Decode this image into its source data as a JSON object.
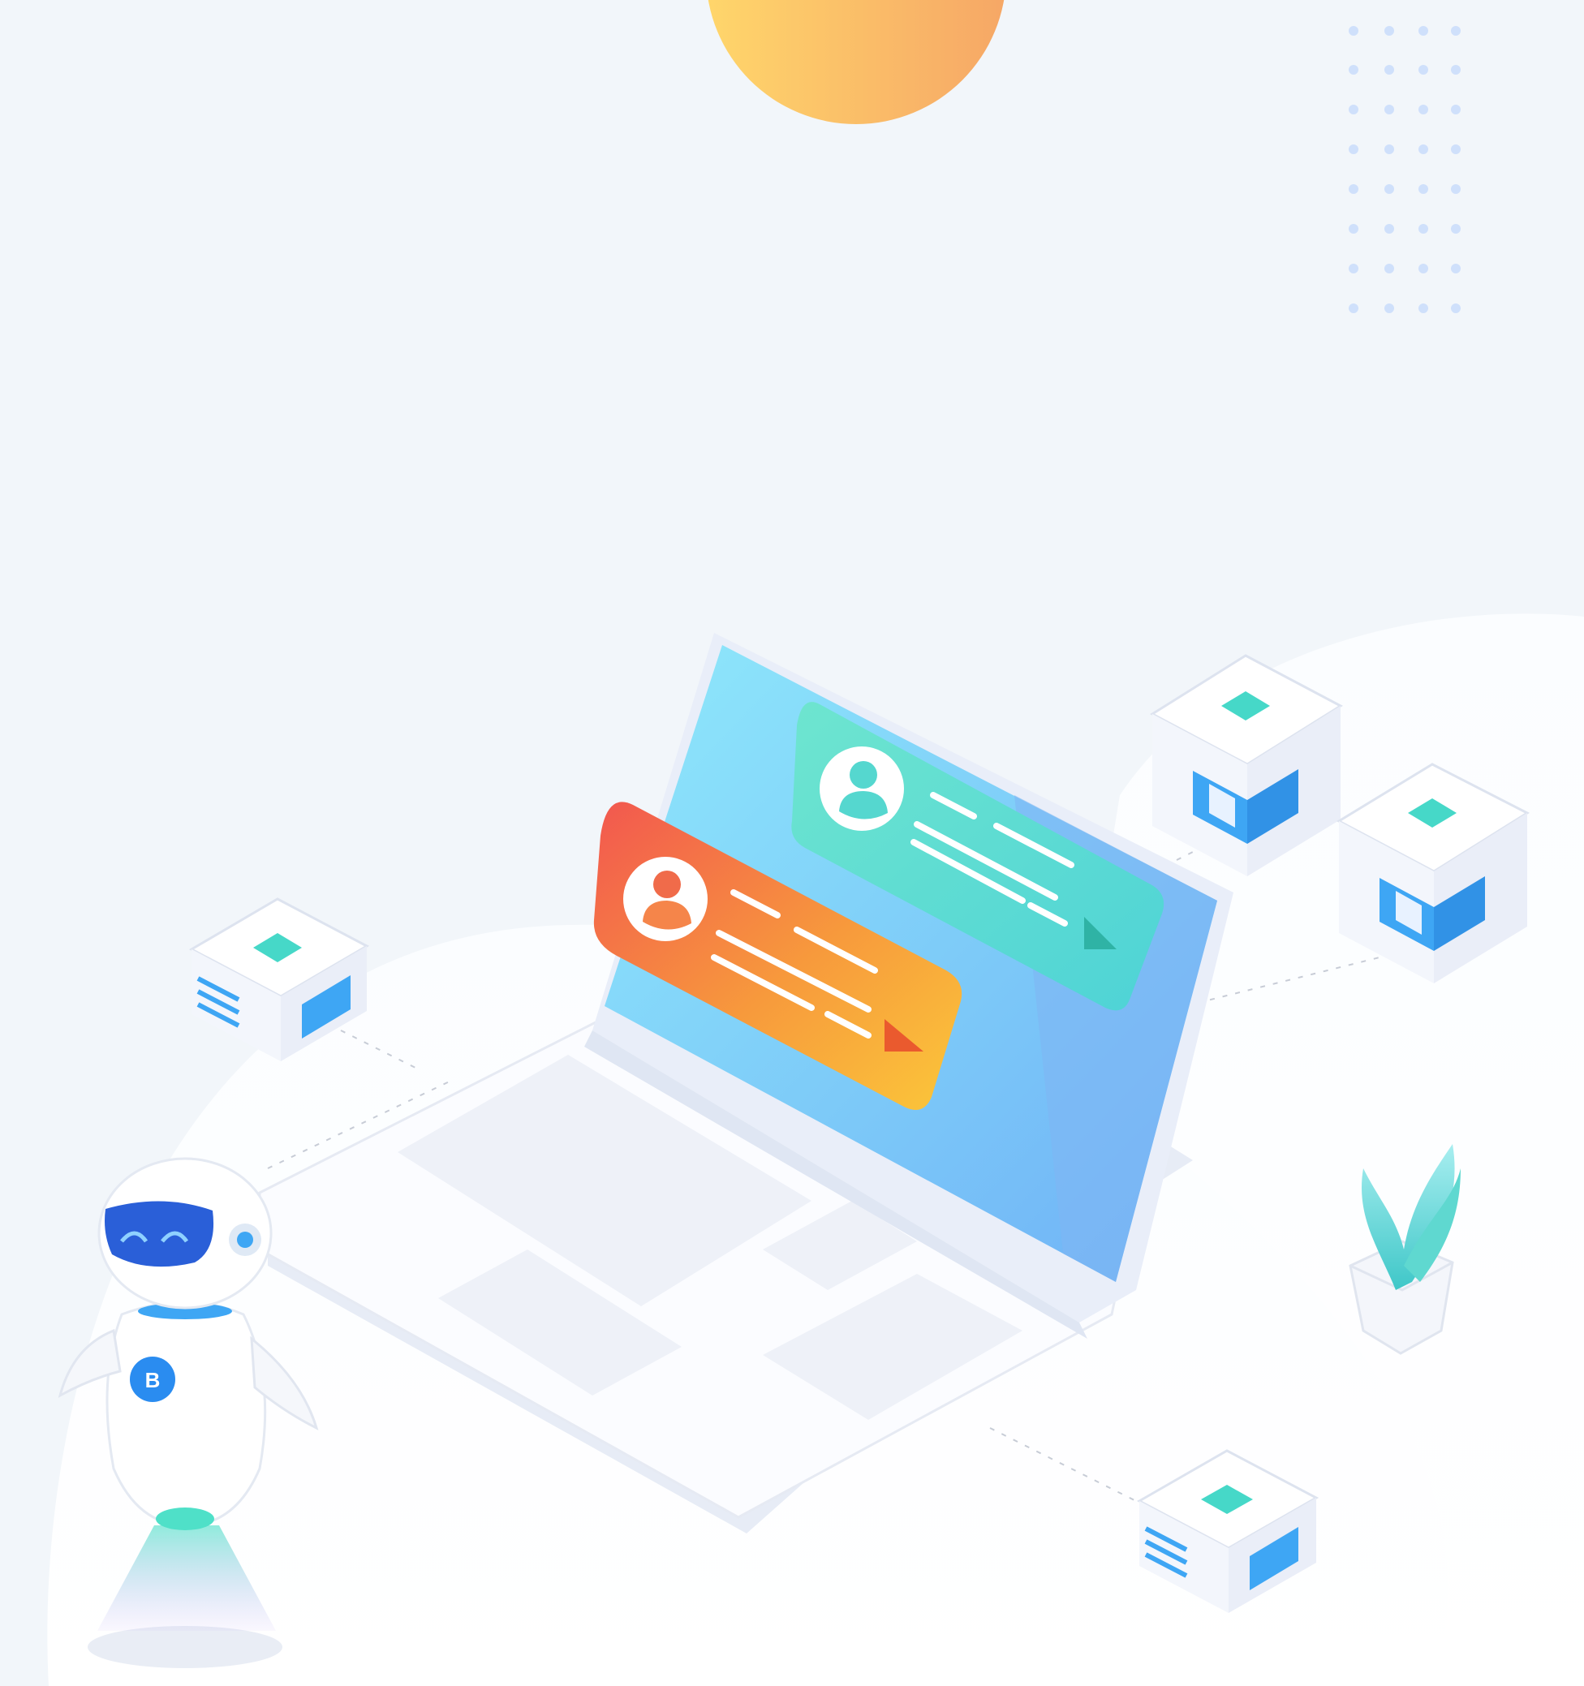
{
  "scene": {
    "description_icon": "laptop-chat-illustration-icon",
    "colors": {
      "background": "#f2f6fa",
      "ground": "#ffffff",
      "sun_start": "#ffd66b",
      "sun_end": "#f6a766",
      "dot_grid": "#cfe0fb",
      "screen_start": "#8fe9fb",
      "screen_end": "#6eb0f6",
      "card_teal_start": "#6ee5cf",
      "card_teal_end": "#4ed3d6",
      "card_orange_start": "#f2574f",
      "card_orange_end": "#fbc73a",
      "server_blue": "#3ea6f4",
      "server_teal": "#46d8c8",
      "robot_blue": "#2a8cf0",
      "plant_teal": "#5fd8d0"
    },
    "icons": [
      "sun-icon",
      "dot-grid-icon",
      "laptop-icon",
      "chat-card-teal-icon",
      "chat-card-orange-icon",
      "user-avatar-icon",
      "send-arrow-icon",
      "server-cube-icon",
      "robot-icon",
      "plant-icon"
    ]
  }
}
